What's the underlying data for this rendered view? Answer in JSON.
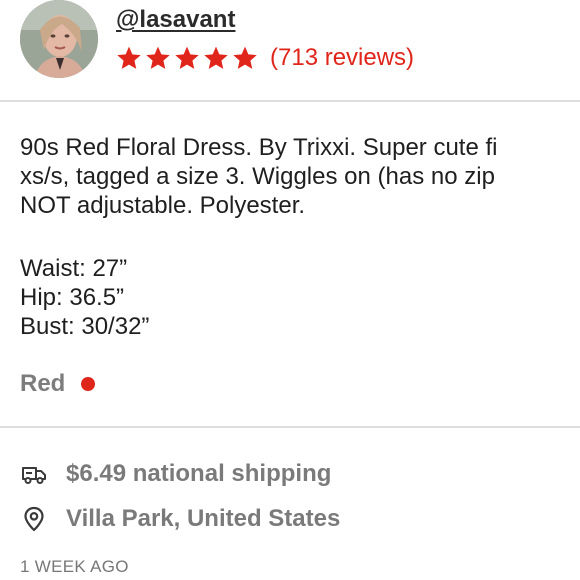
{
  "seller": {
    "username": "@lasavant",
    "rating_stars": 5,
    "reviews_text": "(713 reviews)",
    "star_color": "#e0261b"
  },
  "listing": {
    "description_lines": [
      "90s Red Floral Dress. By Trixxi. Super cute fi",
      "xs/s, tagged a size 3. Wiggles on (has no zip",
      "NOT adjustable. Polyester."
    ],
    "measurements": [
      "Waist: 27”",
      "Hip: 36.5”",
      "Bust: 30/32”"
    ],
    "color": {
      "label": "Red",
      "swatch": "#e0261b"
    }
  },
  "details": {
    "shipping": {
      "icon": "truck-icon",
      "text": "$6.49 national shipping"
    },
    "location": {
      "icon": "location-pin-icon",
      "text": "Villa Park, United States"
    },
    "posted": "1 WEEK AGO"
  }
}
